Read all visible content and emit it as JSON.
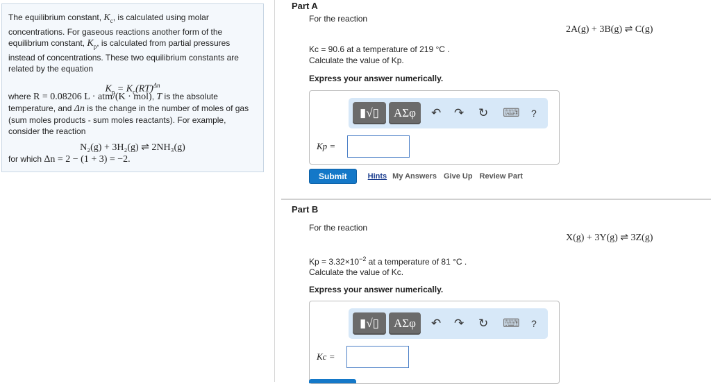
{
  "intro": {
    "p1_a": "The equilibrium constant, ",
    "Kc": "Kc",
    "p1_b": ", is calculated using molar concentrations. For gaseous reactions another form of the equilibrium constant, ",
    "Kp": "Kp",
    "p1_c": ", is calculated from partial pressures instead of concentrations. These two equilibrium constants are related by the equation",
    "equation": "Kp = Kc(RT)^Δn",
    "p2_a": "where ",
    "R_expr": "R = 0.08206 L · atm/(K · mol)",
    "p2_b": ", ",
    "T": "T",
    "p2_c": " is the absolute temperature, and ",
    "dn": "Δn",
    "p2_d": " is the change in the number of moles of gas (sum moles products - sum moles reactants). For example, consider the reaction",
    "example_reaction": "N₂(g) + 3H₂(g) ⇌ 2NH₃(g)",
    "p3_a": "for which ",
    "p3_expr": "Δn = 2 − (1 + 3) = −2."
  },
  "partA": {
    "title": "Part A",
    "for_reaction": "For the reaction",
    "reaction": "2A(g) + 3B(g) ⇌ C(g)",
    "given": "Kc = 90.6 at a temperature of 219 °C .",
    "ask": "Calculate the value of Kp.",
    "instruction": "Express your answer numerically.",
    "answer_label": "Kp =",
    "answer_value": "",
    "submit": "Submit",
    "links": [
      "Hints",
      "My Answers",
      "Give Up",
      "Review Part"
    ]
  },
  "partB": {
    "title": "Part B",
    "for_reaction": "For the reaction",
    "reaction": "X(g) + 3Y(g) ⇌ 3Z(g)",
    "given_a": "Kp = 3.32×10",
    "given_exp": "−2",
    "given_b": " at a temperature of 81 °C .",
    "ask": "Calculate the value of Kc.",
    "instruction": "Express your answer numerically.",
    "answer_label": "Kc =",
    "answer_value": ""
  },
  "toolbar": {
    "templates": "▮√▯",
    "greek": "ΑΣφ",
    "undo": "↶",
    "redo": "↷",
    "reset": "↻",
    "keyboard": "⌨",
    "help": "?"
  }
}
